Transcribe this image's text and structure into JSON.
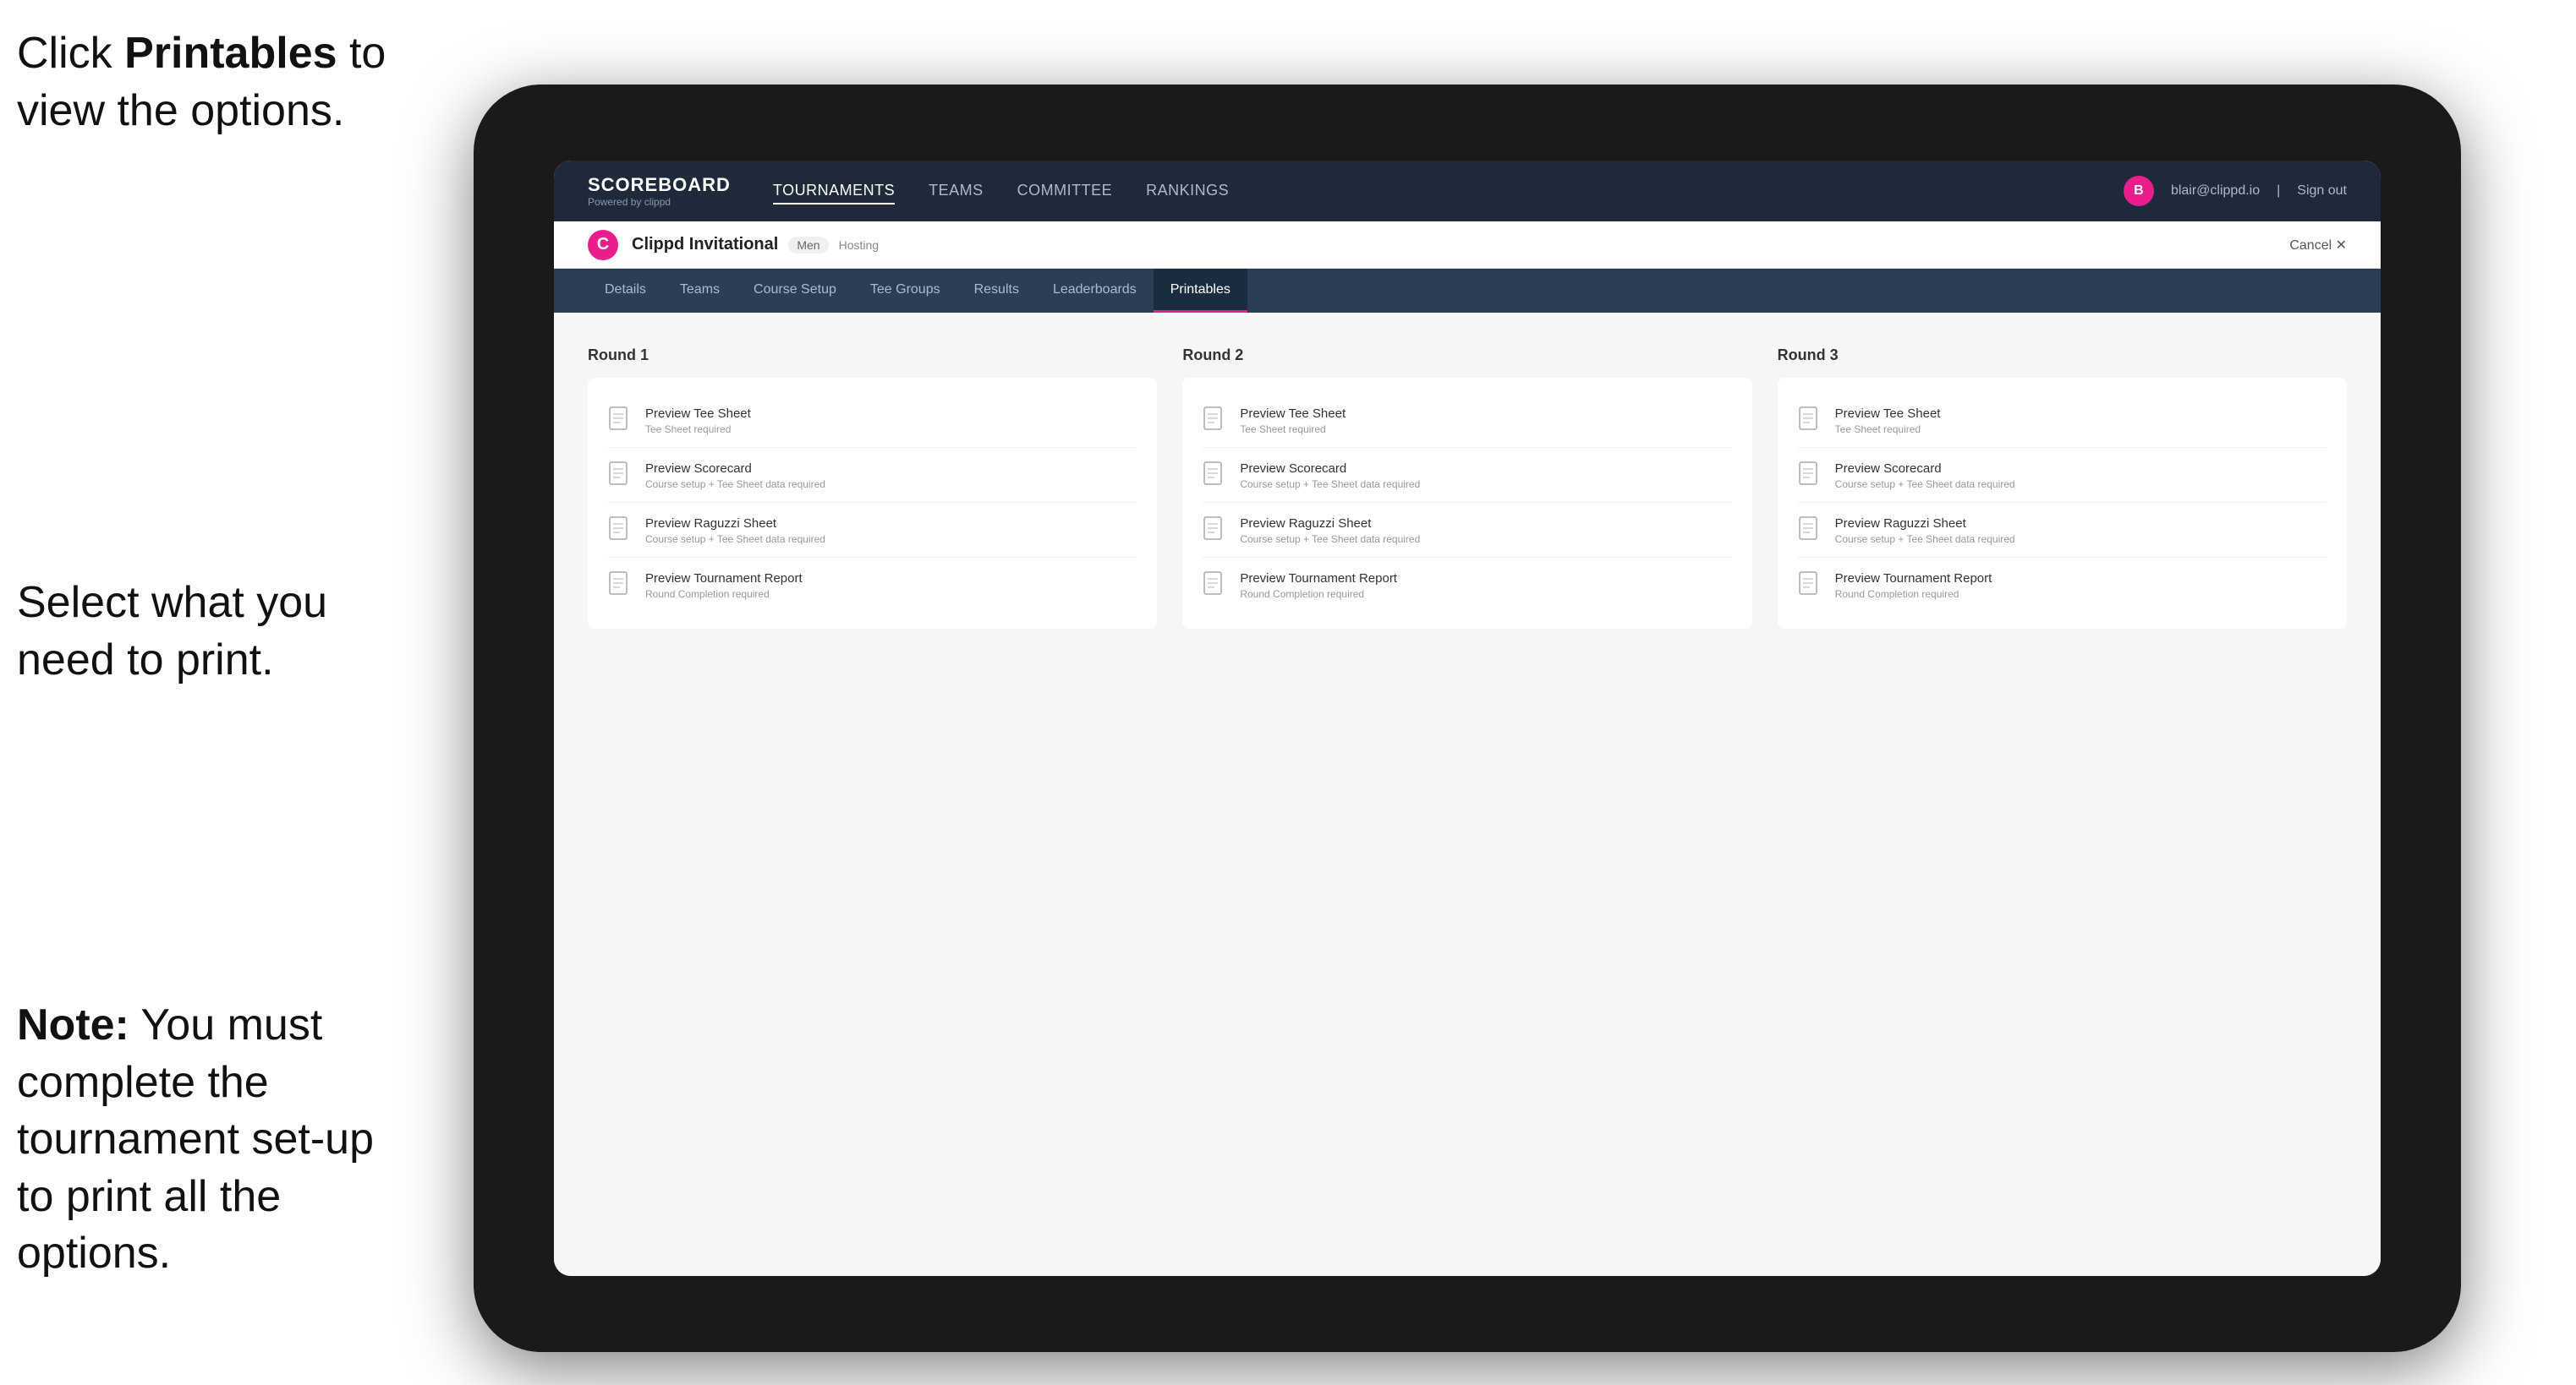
{
  "instructions": {
    "top": {
      "prefix": "Click ",
      "bold": "Printables",
      "suffix": " to\nview the options."
    },
    "middle": {
      "text": "Select what you\nneed to print."
    },
    "bottom": {
      "bold": "Note:",
      "suffix": " You must\ncomplete the\ntournament set-up\nto print all the options."
    }
  },
  "nav": {
    "brand": "SCOREBOARD",
    "brand_sub": "Powered by clippd",
    "links": [
      "TOURNAMENTS",
      "TEAMS",
      "COMMITTEE",
      "RANKINGS"
    ],
    "active_link": "TOURNAMENTS",
    "user_email": "blair@clippd.io",
    "sign_out": "Sign out"
  },
  "tournament": {
    "name": "Clippd Invitational",
    "badge": "Men",
    "status": "Hosting",
    "cancel": "Cancel"
  },
  "sub_tabs": [
    "Details",
    "Teams",
    "Course Setup",
    "Tee Groups",
    "Results",
    "Leaderboards",
    "Printables"
  ],
  "active_tab": "Printables",
  "rounds": [
    {
      "title": "Round 1",
      "items": [
        {
          "label": "Preview Tee Sheet",
          "sub": "Tee Sheet required"
        },
        {
          "label": "Preview Scorecard",
          "sub": "Course setup + Tee Sheet data required"
        },
        {
          "label": "Preview Raguzzi Sheet",
          "sub": "Course setup + Tee Sheet data required"
        },
        {
          "label": "Preview Tournament Report",
          "sub": "Round Completion required"
        }
      ]
    },
    {
      "title": "Round 2",
      "items": [
        {
          "label": "Preview Tee Sheet",
          "sub": "Tee Sheet required"
        },
        {
          "label": "Preview Scorecard",
          "sub": "Course setup + Tee Sheet data required"
        },
        {
          "label": "Preview Raguzzi Sheet",
          "sub": "Course setup + Tee Sheet data required"
        },
        {
          "label": "Preview Tournament Report",
          "sub": "Round Completion required"
        }
      ]
    },
    {
      "title": "Round 3",
      "items": [
        {
          "label": "Preview Tee Sheet",
          "sub": "Tee Sheet required"
        },
        {
          "label": "Preview Scorecard",
          "sub": "Course setup + Tee Sheet data required"
        },
        {
          "label": "Preview Raguzzi Sheet",
          "sub": "Course setup + Tee Sheet data required"
        },
        {
          "label": "Preview Tournament Report",
          "sub": "Round Completion required"
        }
      ]
    }
  ]
}
